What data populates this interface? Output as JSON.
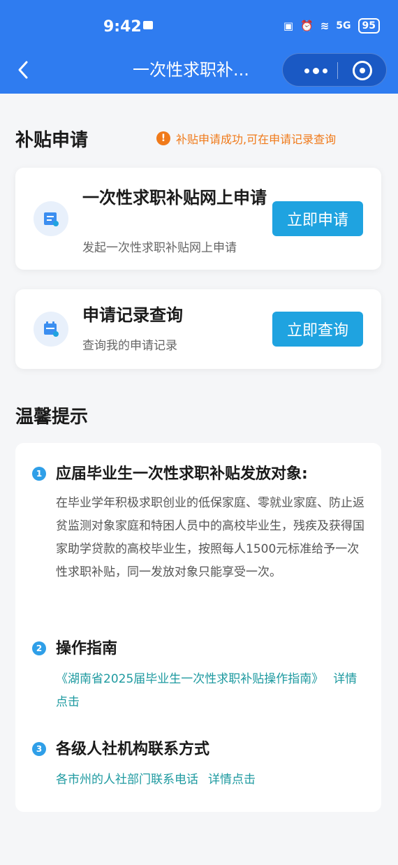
{
  "status_bar": {
    "time": "9:42",
    "signal": "5G",
    "battery": "95"
  },
  "nav": {
    "title": "一次性求职补..."
  },
  "apply_section": {
    "title": "补贴申请",
    "notice_icon": "!",
    "notice": "补贴申请成功,可在申请记录查询"
  },
  "cards": [
    {
      "title": "一次性求职补贴网上申请",
      "subtitle": "发起一次性求职补贴网上申请",
      "button": "立即申请",
      "icon": "apply-form-icon"
    },
    {
      "title": "申请记录查询",
      "subtitle": "查询我的申请记录",
      "button": "立即查询",
      "icon": "calendar-record-icon"
    }
  ],
  "tips_section": {
    "title": "温馨提示",
    "items": [
      {
        "num": "1",
        "heading": "应届毕业生一次性求职补贴发放对象:",
        "body": "在毕业学年积极求职创业的低保家庭、零就业家庭、防止返贫监测对象家庭和特困人员中的高校毕业生，残疾及获得国家助学贷款的高校毕业生，按照每人1500元标准给予一次性求职补贴，同一发放对象只能享受一次。"
      },
      {
        "num": "2",
        "heading": "操作指南",
        "link": "《湖南省2025届毕业生一次性求职补贴操作指南》",
        "detail": "详情点击"
      },
      {
        "num": "3",
        "heading": "各级人社机构联系方式",
        "link": "各市州的人社部门联系电话",
        "detail": "详情点击"
      }
    ]
  },
  "colors": {
    "header": "#2f7cf0",
    "button": "#1fa3e0",
    "notice": "#f07a1a",
    "link": "#1e9aa0"
  }
}
